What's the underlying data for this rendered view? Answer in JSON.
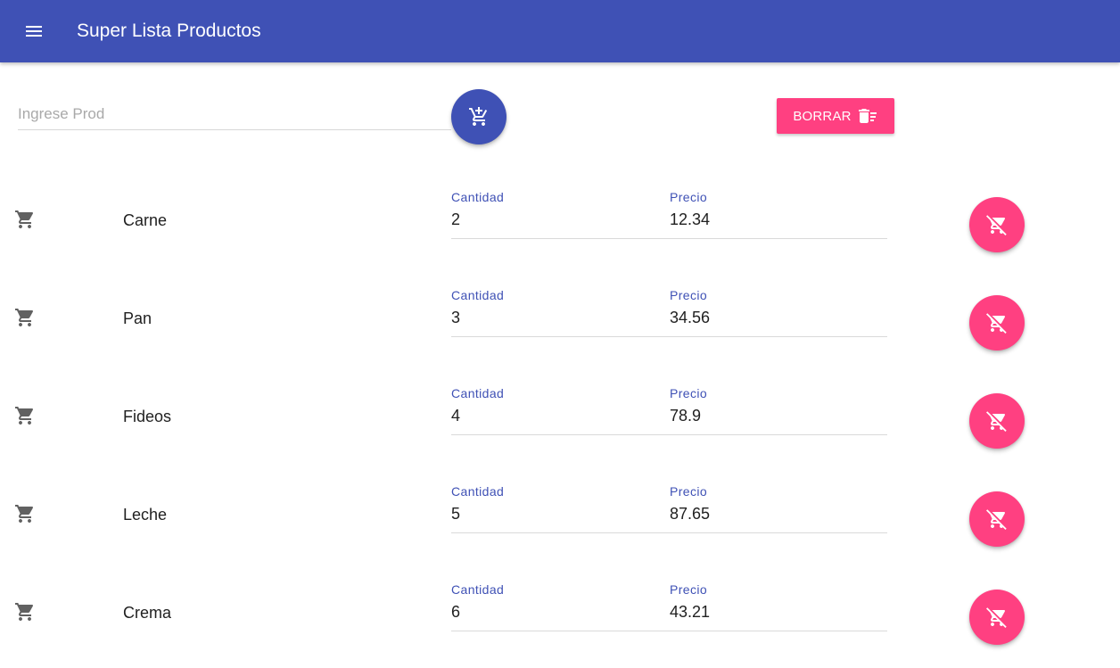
{
  "toolbar": {
    "title": "Super Lista Productos",
    "menu_icon": "menu-icon",
    "color": "#3f51b5"
  },
  "new_product": {
    "placeholder": "Ingrese Prod",
    "value": "",
    "add_icon": "add-shopping-cart-icon"
  },
  "clear_button": {
    "label": "BORRAR",
    "icon": "delete-sweep-icon",
    "color": "#ff4081"
  },
  "products": [
    {
      "name": "Carne",
      "qty_label": "Cantidad",
      "qty": "2",
      "price_label": "Precio",
      "price": "12.34"
    },
    {
      "name": "Pan",
      "qty_label": "Cantidad",
      "qty": "3",
      "price_label": "Precio",
      "price": "34.56"
    },
    {
      "name": "Fideos",
      "qty_label": "Cantidad",
      "qty": "4",
      "price_label": "Precio",
      "price": "78.9"
    },
    {
      "name": "Leche",
      "qty_label": "Cantidad",
      "qty": "5",
      "price_label": "Precio",
      "price": "87.65"
    },
    {
      "name": "Crema",
      "qty_label": "Cantidad",
      "qty": "6",
      "price_label": "Precio",
      "price": "43.21"
    }
  ],
  "row_icons": {
    "item": "shopping-cart-icon",
    "remove": "remove-shopping-cart-icon"
  }
}
